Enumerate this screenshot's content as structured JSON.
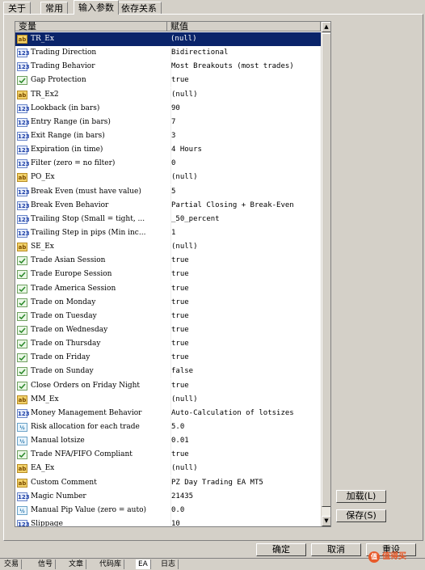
{
  "tabs": [
    {
      "label": "关于"
    },
    {
      "label": "常用"
    },
    {
      "label": "输入参数"
    },
    {
      "label": "依存关系"
    }
  ],
  "table": {
    "col_name": "变量",
    "col_value": "赋值",
    "rows": [
      {
        "icon": "ab",
        "name": "TR_Ex",
        "value": "(null)"
      },
      {
        "icon": "123",
        "name": "Trading Direction",
        "value": "Bidirectional"
      },
      {
        "icon": "123",
        "name": "Trading Behavior",
        "value": "Most Breakouts (most trades)"
      },
      {
        "icon": "chk",
        "name": "Gap Protection",
        "value": "true"
      },
      {
        "icon": "ab",
        "name": "TR_Ex2",
        "value": "(null)"
      },
      {
        "icon": "123",
        "name": "Lookback (in bars)",
        "value": "90"
      },
      {
        "icon": "123",
        "name": "Entry Range (in bars)",
        "value": "7"
      },
      {
        "icon": "123",
        "name": "Exit Range (in bars)",
        "value": "3"
      },
      {
        "icon": "123",
        "name": "Expiration (in time)",
        "value": "4 Hours"
      },
      {
        "icon": "123",
        "name": "Filter (zero = no filter)",
        "value": "0"
      },
      {
        "icon": "ab",
        "name": "PO_Ex",
        "value": "(null)"
      },
      {
        "icon": "123",
        "name": "Break Even (must have value)",
        "value": "5"
      },
      {
        "icon": "123",
        "name": "Break Even Behavior",
        "value": "Partial Closing + Break-Even"
      },
      {
        "icon": "123",
        "name": "Trailing Stop (Small = tight, ...",
        "value": "_50_percent"
      },
      {
        "icon": "123",
        "name": "Trailing Step in pips (Min inc...",
        "value": "1"
      },
      {
        "icon": "ab",
        "name": "SE_Ex",
        "value": "(null)"
      },
      {
        "icon": "chk",
        "name": "Trade Asian Session",
        "value": "true"
      },
      {
        "icon": "chk",
        "name": "Trade Europe Session",
        "value": "true"
      },
      {
        "icon": "chk",
        "name": "Trade America Session",
        "value": "true"
      },
      {
        "icon": "chk",
        "name": "Trade on Monday",
        "value": "true"
      },
      {
        "icon": "chk",
        "name": "Trade on Tuesday",
        "value": "true"
      },
      {
        "icon": "chk",
        "name": "Trade on Wednesday",
        "value": "true"
      },
      {
        "icon": "chk",
        "name": "Trade on Thursday",
        "value": "true"
      },
      {
        "icon": "chk",
        "name": "Trade on Friday",
        "value": "true"
      },
      {
        "icon": "chk",
        "name": "Trade on Sunday",
        "value": "false"
      },
      {
        "icon": "chk",
        "name": "Close Orders on Friday Night",
        "value": "true"
      },
      {
        "icon": "ab",
        "name": "MM_Ex",
        "value": "(null)"
      },
      {
        "icon": "123",
        "name": "Money Management Behavior",
        "value": "Auto-Calculation of lotsizes"
      },
      {
        "icon": "frac",
        "name": "Risk allocation for each trade",
        "value": "5.0"
      },
      {
        "icon": "frac",
        "name": "Manual lotsize",
        "value": "0.01"
      },
      {
        "icon": "chk",
        "name": "Trade NFA/FIFO Compliant",
        "value": "true"
      },
      {
        "icon": "ab",
        "name": "EA_Ex",
        "value": "(null)"
      },
      {
        "icon": "ab",
        "name": "Custom Comment",
        "value": "PZ Day Trading EA MT5"
      },
      {
        "icon": "123",
        "name": "Magic Number",
        "value": "21435"
      },
      {
        "icon": "frac",
        "name": "Manual Pip Value (zero = auto)",
        "value": "0.0"
      },
      {
        "icon": "123",
        "name": "Slippage",
        "value": "10"
      }
    ]
  },
  "buttons": {
    "load": "加载(L)",
    "save": "保存(S)",
    "ok": "确定",
    "cancel": "取消",
    "reset": "重设"
  },
  "bottom_tabs": [
    "交易",
    "信号",
    "文章",
    "代码库",
    "EA",
    "日志"
  ],
  "watermark": "值得买"
}
